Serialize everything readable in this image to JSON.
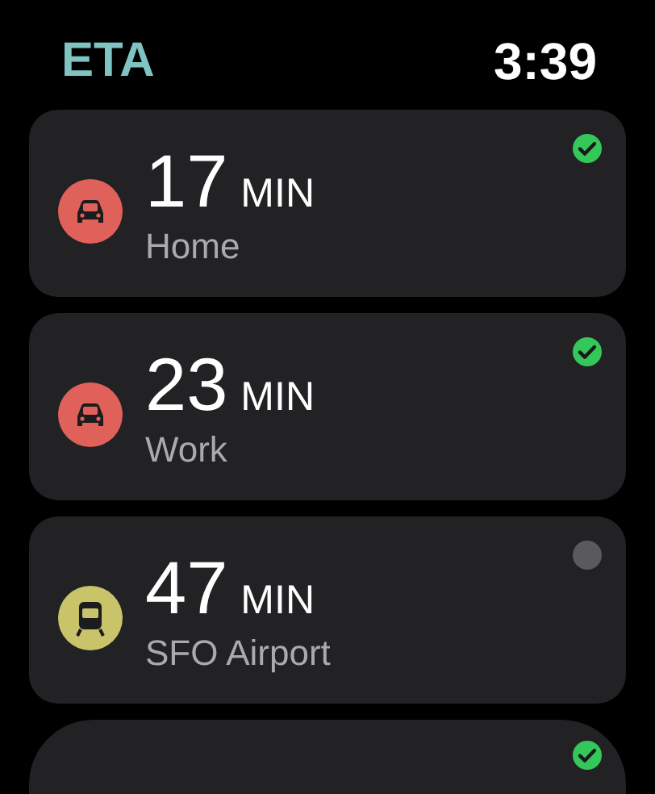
{
  "header": {
    "title": "ETA",
    "time": "3:39"
  },
  "destinations": [
    {
      "kind": "car",
      "minutes": "17",
      "unit": "MIN",
      "name": "Home",
      "checked": true
    },
    {
      "kind": "car",
      "minutes": "23",
      "unit": "MIN",
      "name": "Work",
      "checked": true
    },
    {
      "kind": "train",
      "minutes": "47",
      "unit": "MIN",
      "name": "SFO Airport",
      "checked": false
    },
    {
      "kind": "partial",
      "checked": true
    }
  ]
}
